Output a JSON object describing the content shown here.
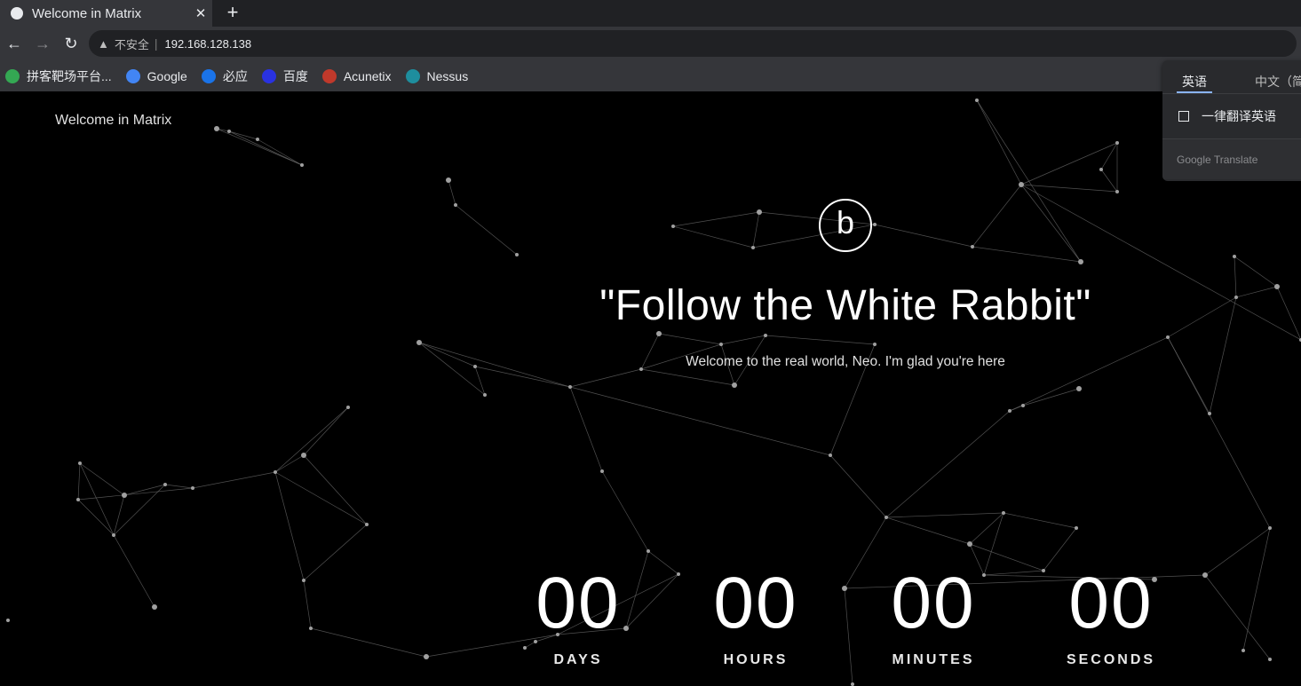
{
  "browser": {
    "tab_title": "Welcome in Matrix",
    "close_glyph": "✕",
    "new_tab_glyph": "+",
    "back_glyph": "←",
    "forward_glyph": "→",
    "reload_glyph": "↻",
    "warning_glyph": "▲",
    "security_label": "不安全",
    "separator": "|",
    "url": "192.168.128.138"
  },
  "bookmarks": [
    {
      "label": "拼客靶场平台...",
      "icon": "green-globe-icon",
      "color": "#34a853"
    },
    {
      "label": "Google",
      "icon": "google-icon",
      "color": "#4285f4"
    },
    {
      "label": "必应",
      "icon": "bing-icon",
      "color": "#1a73e8"
    },
    {
      "label": "百度",
      "icon": "baidu-icon",
      "color": "#2932e1"
    },
    {
      "label": "Acunetix",
      "icon": "acunetix-icon",
      "color": "#c0392b"
    },
    {
      "label": "Nessus",
      "icon": "nessus-icon",
      "color": "#1e8e9e"
    }
  ],
  "page": {
    "brand": "Welcome in Matrix",
    "logo_letter": "b",
    "headline": "\"Follow the White Rabbit\"",
    "subline": "Welcome to the real world, Neo. I'm glad you're here",
    "counters": [
      {
        "value": "00",
        "label": "DAYS"
      },
      {
        "value": "00",
        "label": "HOURS"
      },
      {
        "value": "00",
        "label": "MINUTES"
      },
      {
        "value": "00",
        "label": "SECONDS"
      }
    ]
  },
  "translate_popup": {
    "tab_source": "英语",
    "tab_target": "中文（简",
    "option": "一律翻译英语",
    "footer": "Google Translate"
  }
}
